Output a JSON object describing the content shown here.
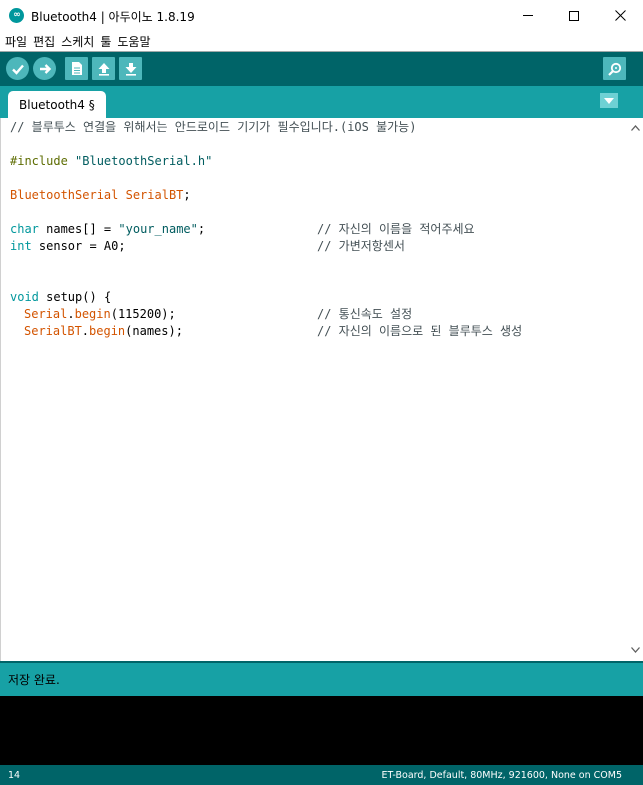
{
  "window": {
    "title": "Bluetooth4 | 아두이노 1.8.19",
    "logo_text": "∞"
  },
  "menu": {
    "items": [
      "파일",
      "편집",
      "스케치",
      "툴",
      "도움말"
    ]
  },
  "toolbar": {
    "icons": [
      "verify-check-icon",
      "upload-arrow-icon",
      "new-file-icon",
      "open-up-arrow-icon",
      "save-down-arrow-icon",
      "serial-monitor-magnifier-icon"
    ]
  },
  "tabs": {
    "active": "Bluetooth4 §"
  },
  "code": {
    "line1": {
      "comment": "// 블루투스 연결을 위해서는 안드로이드 기기가 필수입니다.(iOS 불가능)"
    },
    "line3": {
      "pre": "#include ",
      "str": "\"BluetoothSerial.h\""
    },
    "line5": {
      "t1": "BluetoothSerial",
      "t2": " SerialBT",
      "p": ";"
    },
    "line7": {
      "kw": "char",
      "plain": " names[] = ",
      "str": "\"your_name\"",
      "end": ";",
      "comment": "// 자신의 이름을 적어주세요"
    },
    "line8": {
      "kw": "int",
      "plain": " sensor = A0;",
      "comment": "// 가변저항센서"
    },
    "line11": {
      "kw": "void",
      "fn": " setup",
      "plain": "() {"
    },
    "line12": {
      "obj": "Serial",
      "dot": ".",
      "fn": "begin",
      "plain": "(115200);",
      "comment": "// 통신속도 설정"
    },
    "line13": {
      "obj": "SerialBT",
      "dot": ".",
      "fn": "begin",
      "plain": "(names);",
      "comment": "// 자신의 이름으로 된 블루투스 생성"
    }
  },
  "status": {
    "message": "저장 완료."
  },
  "footer": {
    "line_number": "14",
    "board_info": "ET-Board, Default, 80MHz, 921600, None on COM5"
  },
  "colors": {
    "toolbar_bg": "#006468",
    "tab_strip_bg": "#17a1a5",
    "button_bg": "#4db7bb",
    "comment": "#434f54",
    "keyword": "#d35400",
    "type": "#00979c"
  }
}
